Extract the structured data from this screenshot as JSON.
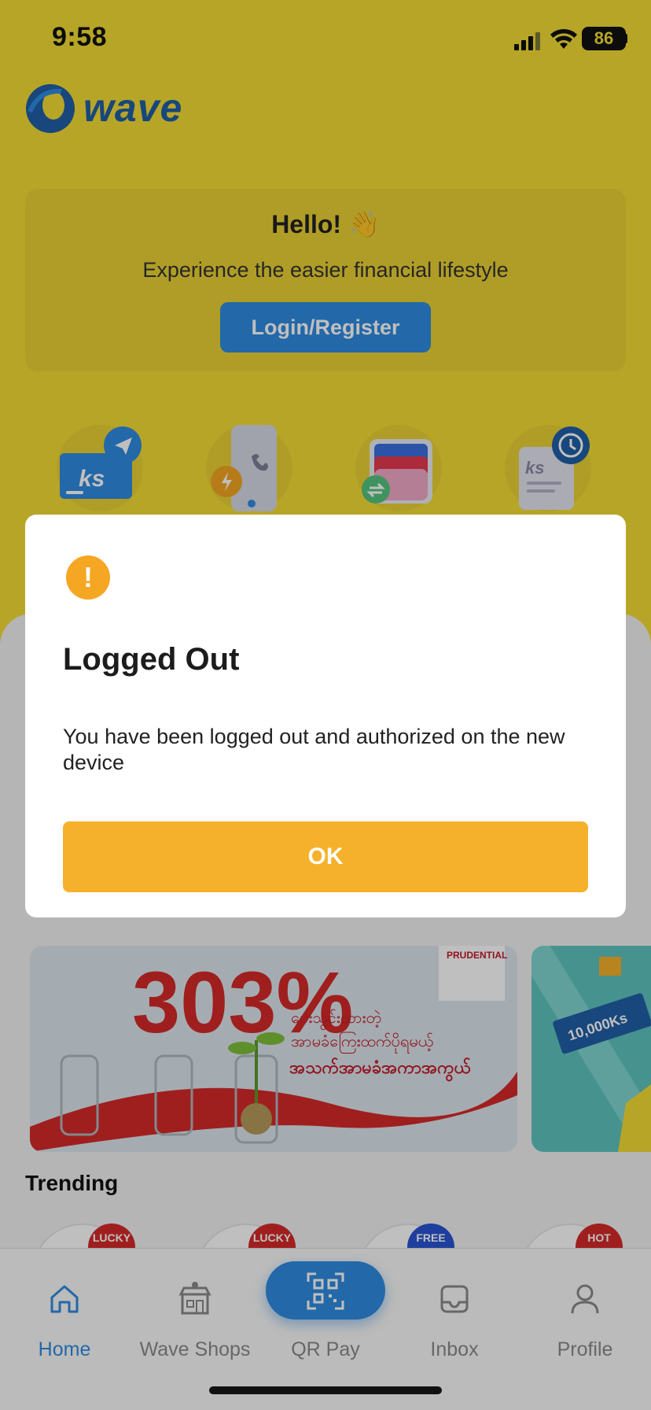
{
  "status_bar": {
    "time": "9:58",
    "battery": "86"
  },
  "app": {
    "logo_text": "wave"
  },
  "hero": {
    "greeting": "Hello! 👋",
    "subtitle": "Experience the easier financial lifestyle",
    "login_label": "Login/Register"
  },
  "quick_actions": [
    {
      "icon": "send-money-icon"
    },
    {
      "icon": "mobile-topup-icon"
    },
    {
      "icon": "wallet-transfer-icon"
    },
    {
      "icon": "transaction-history-icon"
    }
  ],
  "promo_banners": [
    {
      "text": "ပေးသွင်းထားတဲ့ အာမခံကြေးထက်ပိုရမယ့် အသက်အာမခံအကာအကွယ်",
      "big": "303%",
      "brand": "PRUDENTIAL"
    },
    {
      "text": "10,000Ks"
    }
  ],
  "trending": {
    "title": "Trending",
    "badges": [
      "LUCKY",
      "LUCKY",
      "FREE",
      "HOT"
    ]
  },
  "nav": {
    "items": [
      {
        "label": "Home",
        "icon": "home-icon",
        "active": true
      },
      {
        "label": "Wave Shops",
        "icon": "shop-icon",
        "active": false
      },
      {
        "label": "QR Pay",
        "icon": "qr-icon",
        "active": false
      },
      {
        "label": "Inbox",
        "icon": "inbox-icon",
        "active": false
      },
      {
        "label": "Profile",
        "icon": "profile-icon",
        "active": false
      }
    ]
  },
  "dialog": {
    "title": "Logged Out",
    "message": "You have been logged out and authorized on the new device",
    "ok_label": "OK"
  },
  "colors": {
    "brand_yellow": "#f4dc35",
    "brand_blue": "#2f8be0",
    "ok_orange": "#f5b12b",
    "warn_orange": "#f5a623"
  }
}
